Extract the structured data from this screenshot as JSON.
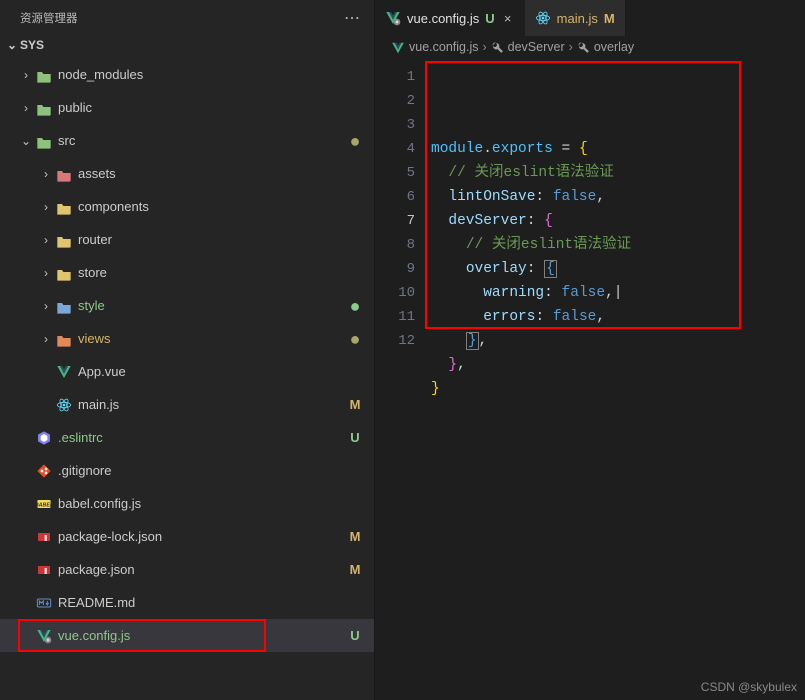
{
  "sidebar": {
    "title": "资源管理器",
    "section": "SYS",
    "tree": [
      {
        "label": "node_modules",
        "indent": 1,
        "chev": ">",
        "iconColor": "#8dc27d",
        "type": "folder-module"
      },
      {
        "label": "public",
        "indent": 1,
        "chev": ">",
        "iconColor": "#8dc27d",
        "type": "folder-public"
      },
      {
        "label": "src",
        "indent": 1,
        "chev": "v",
        "iconColor": "#8dc27d",
        "type": "folder",
        "dotClass": "olive"
      },
      {
        "label": "assets",
        "indent": 2,
        "chev": ">",
        "iconColor": "#d97878",
        "type": "folder"
      },
      {
        "label": "components",
        "indent": 2,
        "chev": ">",
        "iconColor": "#e0c56e",
        "type": "folder"
      },
      {
        "label": "router",
        "indent": 2,
        "chev": ">",
        "iconColor": "#e0c56e",
        "type": "folder-router"
      },
      {
        "label": "store",
        "indent": 2,
        "chev": ">",
        "iconColor": "#e0c56e",
        "type": "folder"
      },
      {
        "label": "style",
        "indent": 2,
        "chev": ">",
        "iconColor": "#7aa7d8",
        "type": "folder-style",
        "labelClass": "green-text",
        "dotClass": ""
      },
      {
        "label": "views",
        "indent": 2,
        "chev": ">",
        "iconColor": "#e08a5a",
        "type": "folder-views",
        "labelClass": "olive-text",
        "dotClass": "olive"
      },
      {
        "label": "App.vue",
        "indent": 2,
        "iconColor": "#41b883",
        "type": "vue"
      },
      {
        "label": "main.js",
        "indent": 2,
        "iconColor": "#61dafb",
        "type": "react",
        "status": "M",
        "statusClass": ""
      },
      {
        "label": ".eslintrc",
        "indent": 1,
        "iconColor": "#8080f2",
        "type": "eslint",
        "status": "U",
        "statusClass": "u",
        "labelClass": "green-text"
      },
      {
        "label": ".gitignore",
        "indent": 1,
        "iconColor": "#e44d26",
        "type": "git"
      },
      {
        "label": "babel.config.js",
        "indent": 1,
        "iconColor": "#f5da55",
        "type": "babel"
      },
      {
        "label": "package-lock.json",
        "indent": 1,
        "iconColor": "#cb3837",
        "type": "npm",
        "status": "M",
        "statusClass": ""
      },
      {
        "label": "package.json",
        "indent": 1,
        "iconColor": "#cb3837",
        "type": "npm",
        "status": "M",
        "statusClass": ""
      },
      {
        "label": "README.md",
        "indent": 1,
        "iconColor": "#6190c8",
        "type": "md"
      },
      {
        "label": "vue.config.js",
        "indent": 1,
        "iconColor": "#41b883",
        "type": "vueconf",
        "status": "U",
        "statusClass": "u",
        "labelClass": "green-text",
        "selected": true,
        "rowHighlight": true
      }
    ]
  },
  "tabs": [
    {
      "name": "vue.config.js",
      "badge": "U",
      "badgeClass": "u",
      "iconColor": "#41b883",
      "type": "vueconf",
      "active": true,
      "close": "×"
    },
    {
      "name": "main.js",
      "badge": "M",
      "badgeClass": "m",
      "iconColor": "#61dafb",
      "type": "react",
      "labelClass": "olive-text"
    }
  ],
  "breadcrumb": {
    "file": "vue.config.js",
    "parts": [
      "devServer",
      "overlay"
    ]
  },
  "code": {
    "lineCount": 12,
    "currentLine": 7,
    "lines": [
      {
        "t": [
          [
            "module",
            "tok-var"
          ],
          [
            ".",
            "tok-punc"
          ],
          [
            "exports",
            "tok-var"
          ],
          [
            " ",
            ""
          ],
          [
            "=",
            "tok-punc"
          ],
          [
            " ",
            ""
          ],
          [
            "{",
            "tok-brace"
          ]
        ]
      },
      {
        "in": 1,
        "t": [
          [
            "// 关闭eslint语法验证",
            "tok-comment"
          ]
        ]
      },
      {
        "in": 1,
        "t": [
          [
            "lintOnSave",
            "tok-prop"
          ],
          [
            ":",
            "tok-punc"
          ],
          [
            " ",
            ""
          ],
          [
            "false",
            "tok-bool"
          ],
          [
            ",",
            "tok-punc"
          ]
        ]
      },
      {
        "in": 1,
        "t": [
          [
            "devServer",
            "tok-prop"
          ],
          [
            ":",
            "tok-punc"
          ],
          [
            " ",
            ""
          ],
          [
            "{",
            "tok-brace2"
          ]
        ]
      },
      {
        "in": 2,
        "t": [
          [
            "// 关闭eslint语法验证",
            "tok-comment"
          ]
        ]
      },
      {
        "in": 2,
        "t": [
          [
            "overlay",
            "tok-prop"
          ],
          [
            ":",
            "tok-punc"
          ],
          [
            " ",
            ""
          ],
          [
            "{",
            "tok-brace3 cursor-box"
          ]
        ]
      },
      {
        "in": 3,
        "t": [
          [
            "warning",
            "tok-prop"
          ],
          [
            ":",
            "tok-punc"
          ],
          [
            " ",
            ""
          ],
          [
            "false",
            "tok-bool"
          ],
          [
            ",",
            "tok-punc"
          ],
          [
            "|",
            ""
          ]
        ]
      },
      {
        "in": 3,
        "t": [
          [
            "errors",
            "tok-prop"
          ],
          [
            ":",
            "tok-punc"
          ],
          [
            " ",
            ""
          ],
          [
            "false",
            "tok-bool"
          ],
          [
            ",",
            "tok-punc"
          ]
        ]
      },
      {
        "in": 2,
        "t": [
          [
            "}",
            "tok-brace3 cursor-box"
          ],
          [
            ",",
            "tok-punc"
          ]
        ]
      },
      {
        "in": 1,
        "t": [
          [
            "}",
            "tok-brace2"
          ],
          [
            ",",
            "tok-punc"
          ]
        ]
      },
      {
        "t": [
          [
            "}",
            "tok-brace"
          ]
        ]
      },
      {
        "t": []
      }
    ]
  },
  "watermark": "CSDN @skybulex"
}
